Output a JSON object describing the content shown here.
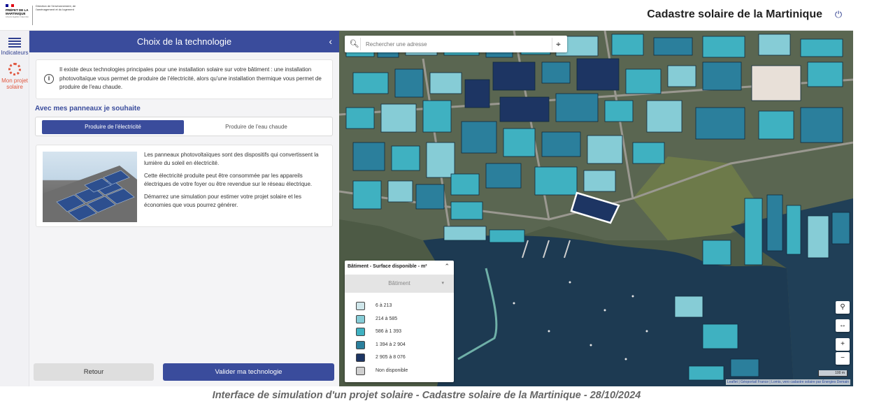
{
  "header": {
    "logo_republic": "PRÉFET DE LA MARTINIQUE",
    "logo_motto": "Liberté Égalité Fraternité",
    "logo_direction": "Direction de l'environnement, de l'aménagement et du logement",
    "app_title": "Cadastre solaire de la Martinique",
    "power_icon": "power-icon"
  },
  "rail": {
    "items": [
      {
        "label": "Indicateurs",
        "icon": "list-icon"
      },
      {
        "label": "Mon projet solaire",
        "icon": "gear-icon"
      }
    ]
  },
  "panel": {
    "title": "Choix de la technologie",
    "info_text": "Il existe deux technologies principales pour une installation solaire sur votre bâtiment : une installation photovoltaïque vous permet de produire de l'électricité, alors qu'une installation thermique vous permet de produire de l'eau chaude.",
    "subtitle": "Avec mes panneaux je souhaite",
    "options": [
      {
        "label": "Produire de l'électricité",
        "selected": true
      },
      {
        "label": "Produire de l'eau chaude",
        "selected": false
      }
    ],
    "pv_paragraphs": [
      "Les panneaux photovoltaïques sont des dispositifs qui convertissent la lumière du soleil en électricité.",
      "Cette électricité produite peut être consommée par les appareils électriques de votre foyer ou être revendue sur le réseau électrique.",
      "Démarrez une simulation pour estimer votre projet solaire et les économies que vous pourrez générer."
    ],
    "back_label": "Retour",
    "validate_label": "Valider ma technologie"
  },
  "map": {
    "search_placeholder": "Rechercher une adresse",
    "legend": {
      "title": "Bâtiment - Surface disponible - m²",
      "select_value": "Bâtiment",
      "classes": [
        {
          "label": "6 à 213",
          "color": "#cfe6ea"
        },
        {
          "label": "214 à 585",
          "color": "#86ccd6"
        },
        {
          "label": "586 à 1 393",
          "color": "#3fb1c1"
        },
        {
          "label": "1 394 à 2 904",
          "color": "#2b7f9c"
        },
        {
          "label": "2 905 à 8 076",
          "color": "#1d3563"
        },
        {
          "label": "Non disponible",
          "color": "#cfcfcf"
        }
      ]
    },
    "scale_label": "100 m",
    "attribution": "Leaflet | Géoportail France | Lomis, vero cadastre solaire par Énergies Demain",
    "controls": [
      "marker-icon",
      "measure-icon",
      "zoom-in",
      "zoom-out"
    ],
    "zoom_in": "+",
    "zoom_out": "−"
  },
  "caption": "Interface de simulation d'un projet solaire - Cadastre solaire de la Martinique - 28/10/2024"
}
